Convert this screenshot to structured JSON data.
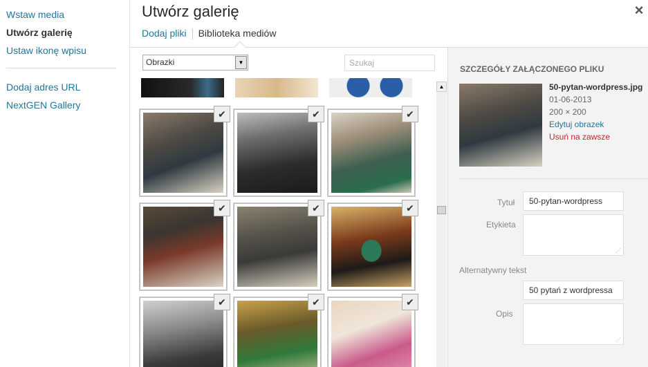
{
  "menu": {
    "items": [
      {
        "label": "Wstaw media"
      },
      {
        "label": "Utwórz galerię"
      },
      {
        "label": "Ustaw ikonę wpisu"
      },
      {
        "label": "Dodaj adres URL"
      },
      {
        "label": "NextGEN Gallery"
      }
    ]
  },
  "header": {
    "title": "Utwórz galerię",
    "close_icon": "×"
  },
  "router": {
    "tab_upload": "Dodaj pliki",
    "tab_library": "Biblioteka mediów"
  },
  "toolbar": {
    "filter_value": "Obrazki",
    "search_placeholder": "Szukaj"
  },
  "grid": {
    "check_glyph": "✔"
  },
  "details": {
    "heading": "SZCZEGÓŁY ZAŁĄCZONEGO PLIKU",
    "filename": "50-pytan-wordpress.jpg",
    "date": "01-06-2013",
    "dimensions": "200 × 200",
    "edit_link": "Edytuj obrazek",
    "delete_link": "Usuń na zawsze",
    "title_label": "Tytuł",
    "title_value": "50-pytan-wordpress",
    "caption_label": "Etykieta",
    "alt_label": "Alternatywny tekst",
    "alt_value": "50 pytań z wordpressa",
    "desc_label": "Opis"
  },
  "colors": {
    "link": "#21759b",
    "delete": "#b32d2e"
  }
}
